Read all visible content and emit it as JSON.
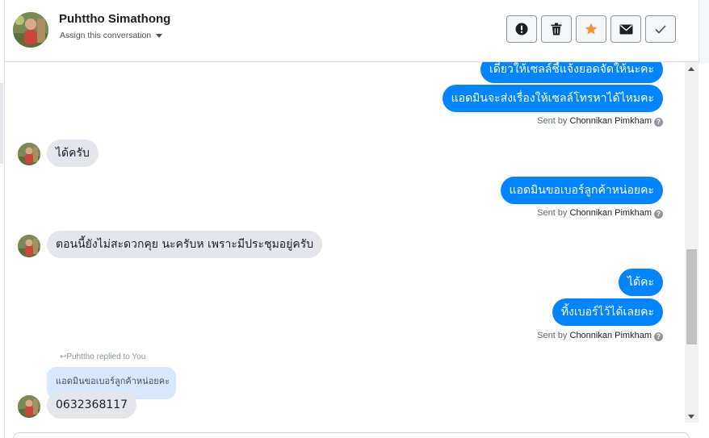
{
  "header": {
    "contact_name": "Puhttho Simathong",
    "assign_label": "Assign this conversation",
    "actions": [
      "alert-icon",
      "trash-icon",
      "star-icon",
      "envelope-icon",
      "check-icon"
    ]
  },
  "colors": {
    "outgoing_bubble": "#0084ff",
    "incoming_bubble": "#e4e6eb",
    "quoted_bubble": "#d6e7ff",
    "star_accent": "#f7923b"
  },
  "messages": {
    "m1": "เดี๋ยวให้เซลล์ชี้แจ้งยอดจัดให้นะคะ",
    "m2": "แอดมินจะส่งเรื่องให้เซลล์โทรหาได้ไหมคะ",
    "sent1_prefix": "Sent by",
    "sent1_agent": "Chonnikan Pimkham",
    "m3": "ได้ครับ",
    "m4": "แอดมินขอเบอร์ลูกค้าหน่อยคะ",
    "sent2_prefix": "Sent by",
    "sent2_agent": "Chonnikan Pimkham",
    "m5": "ตอนนี้ยังไม่สะดวกคุย นะครับห เพราะมีประชุมอยู่ครับ",
    "m6": "ได้คะ",
    "m7": "ทิ้งเบอร์ไว้ได้เลยคะ",
    "sent3_prefix": "Sent by",
    "sent3_agent": "Chonnikan Pimkham",
    "reply_label": "Puhttho replied to You",
    "quoted_text": "แอดมินขอเบอร์ลูกค้าหน่อยคะ",
    "m8": "0632368117"
  }
}
